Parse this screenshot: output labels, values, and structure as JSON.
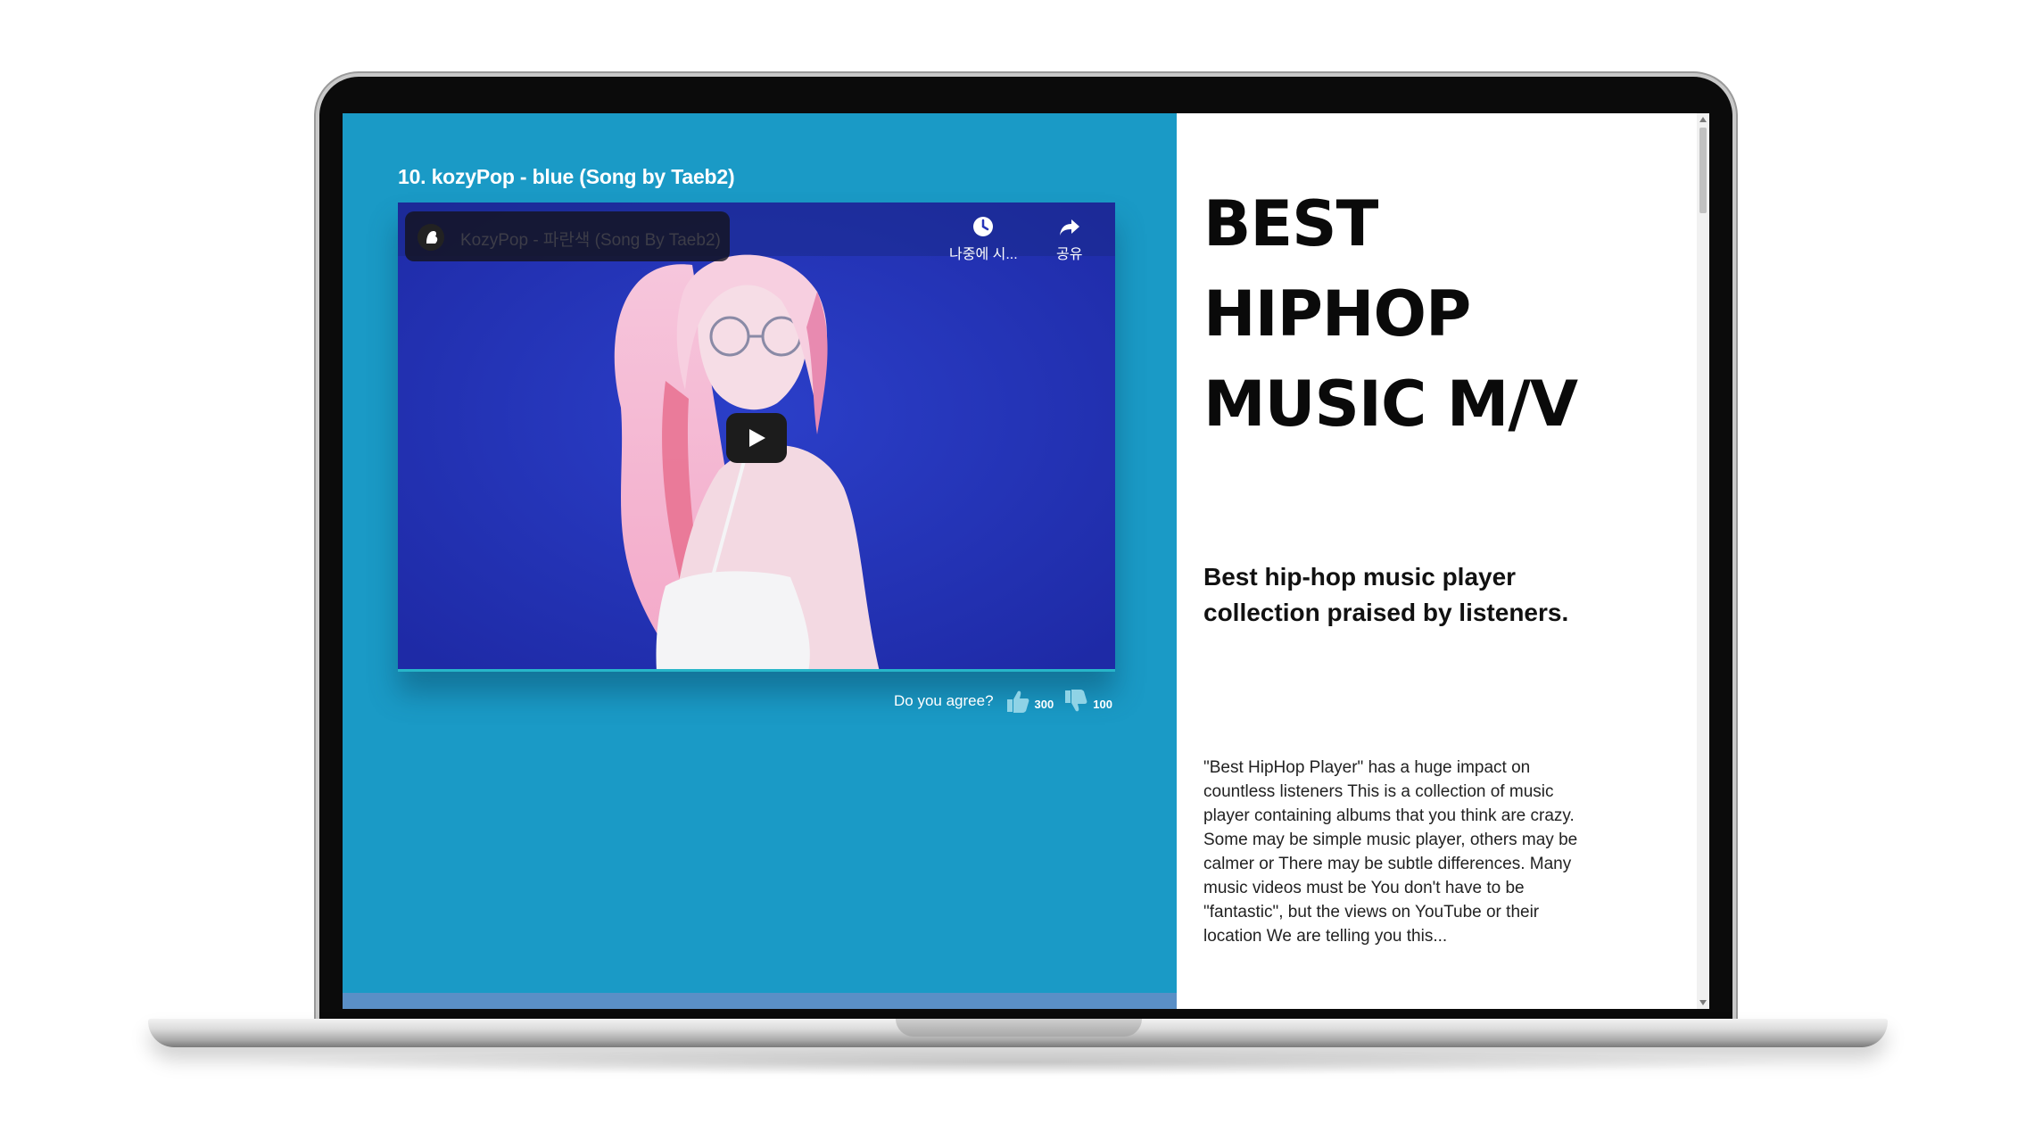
{
  "video": {
    "title": "10. kozyPop - blue (Song by Taeb2)",
    "embed_title": "KozyPop - 파란색 (Song By Taeb2)",
    "watch_later_label": "나중에 시...",
    "share_label": "공유"
  },
  "reactions": {
    "prompt": "Do you agree?",
    "likes": "300",
    "dislikes": "100"
  },
  "info": {
    "headline": [
      "BEST",
      "HIPHOP",
      "MUSIC M/V"
    ],
    "subhead": "Best hip-hop music player collection praised by listeners.",
    "description": "\"Best HipHop Player\" has a huge impact on countless listeners This is a collection of music player containing albums that you think are crazy. Some may be simple music player, others may be calmer or There may be subtle differences. Many music videos must be You don't have to be \"fantastic\", but the views on YouTube or their location We are telling you this..."
  },
  "colors": {
    "left_panel": "#1a9ac6",
    "video_bg": "#2634b8",
    "bottom_strip": "#5a8fc6"
  }
}
